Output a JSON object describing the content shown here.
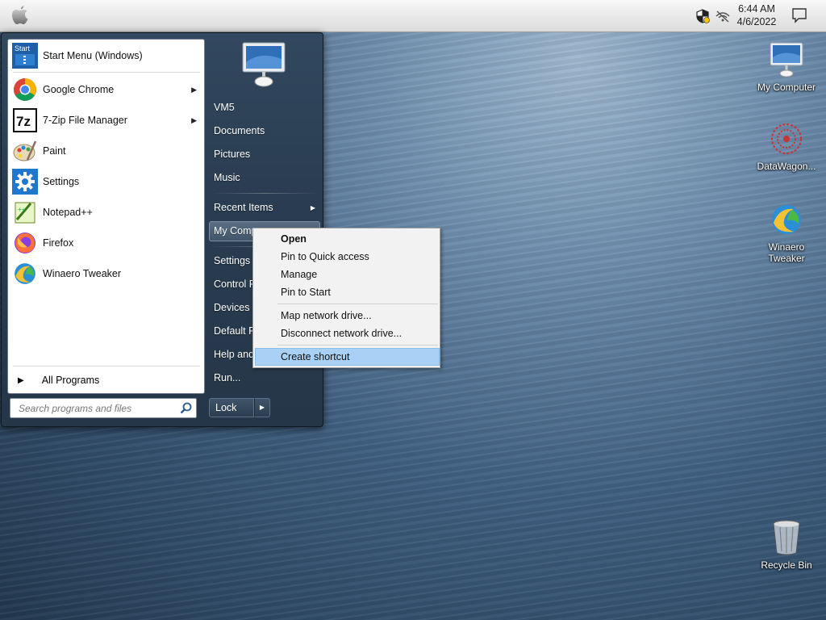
{
  "topbar": {
    "time": "6:44 AM",
    "date": "4/6/2022"
  },
  "desktop_icons": [
    {
      "label": "My Computer",
      "icon": "monitor-icon"
    },
    {
      "label": "DataWagon...",
      "icon": "datawagon-icon"
    },
    {
      "label": "Winaero Tweaker",
      "icon": "winaero-icon"
    },
    {
      "label": "Recycle Bin",
      "icon": "recycle-bin-icon"
    }
  ],
  "start_menu": {
    "programs": [
      {
        "label": "Start Menu (Windows)",
        "icon": "start-menu-icon",
        "has_arrow": false
      },
      {
        "label": "Google Chrome",
        "icon": "chrome-icon",
        "has_arrow": true
      },
      {
        "label": "7-Zip File Manager",
        "icon": "7zip-icon",
        "has_arrow": true
      },
      {
        "label": "Paint",
        "icon": "paint-icon",
        "has_arrow": false
      },
      {
        "label": "Settings",
        "icon": "settings-gear-icon",
        "has_arrow": false
      },
      {
        "label": "Notepad++",
        "icon": "notepad-plus-plus-icon",
        "has_arrow": false
      },
      {
        "label": "Firefox",
        "icon": "firefox-icon",
        "has_arrow": false
      },
      {
        "label": "Winaero Tweaker",
        "icon": "winaero-icon",
        "has_arrow": false
      }
    ],
    "all_programs": "All Programs",
    "search_placeholder": "Search programs and files",
    "right_items": [
      "VM5",
      "Documents",
      "Pictures",
      "Music",
      "Recent Items",
      "My Comp",
      "Settings",
      "Control P",
      "Devices a",
      "Default P",
      "Help and",
      "Run..."
    ],
    "lock_label": "Lock"
  },
  "context_menu": {
    "items": [
      "Open",
      "Pin to Quick access",
      "Manage",
      "Pin to Start",
      "Map network drive...",
      "Disconnect network drive...",
      "Create shortcut"
    ],
    "selected": "Create shortcut"
  }
}
